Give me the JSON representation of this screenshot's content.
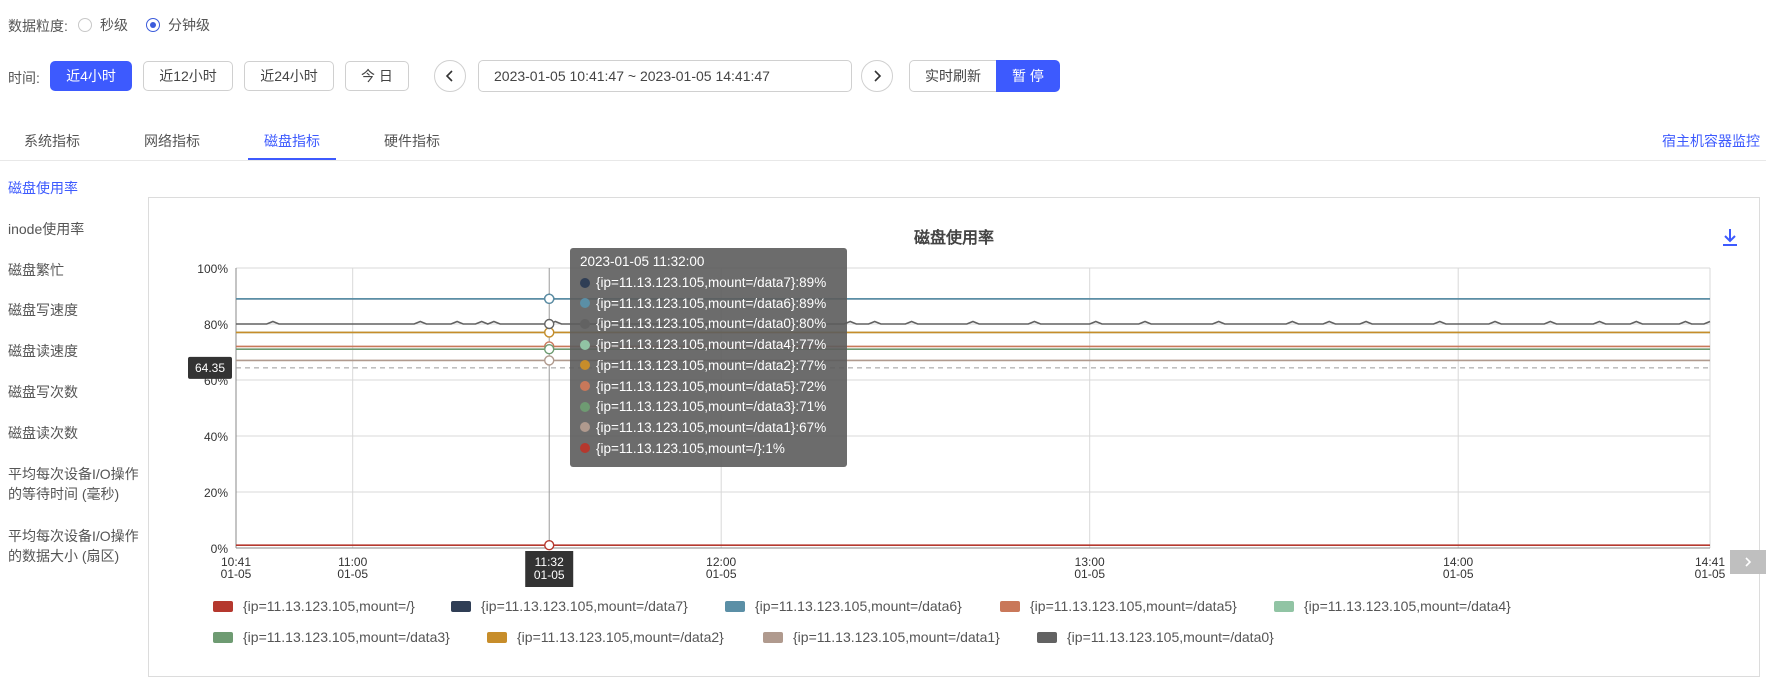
{
  "granularity": {
    "label": "数据粒度:",
    "options": [
      "秒级",
      "分钟级"
    ],
    "selected": "分钟级"
  },
  "time": {
    "label": "时间:",
    "quick": [
      "近4小时",
      "近12小时",
      "近24小时",
      "今 日"
    ],
    "active_quick": "近4小时",
    "range": "2023-01-05 10:41:47 ~ 2023-01-05 14:41:47",
    "realtime": "实时刷新",
    "pause": "暂 停"
  },
  "tabs": [
    "系统指标",
    "网络指标",
    "磁盘指标",
    "硬件指标"
  ],
  "active_tab": "磁盘指标",
  "host_link": "宿主机容器监控",
  "sidebar": [
    "磁盘使用率",
    "inode使用率",
    "磁盘繁忙",
    "磁盘写速度",
    "磁盘读速度",
    "磁盘写次数",
    "磁盘读次数",
    [
      "平均每次设备I/O操作",
      "的等待时间 (毫秒)"
    ],
    [
      "平均每次设备I/O操作",
      "的数据大小 (扇区)"
    ]
  ],
  "chart_data": {
    "type": "line",
    "title": "磁盘使用率",
    "y_ticks": [
      "100%",
      "80%",
      "60%",
      "40%",
      "20%",
      "0%"
    ],
    "ylim": [
      0,
      100
    ],
    "x_ticks": [
      {
        "t": 0,
        "time": "10:41",
        "date": "01-05"
      },
      {
        "t": 19,
        "time": "11:00",
        "date": "01-05"
      },
      {
        "t": 79,
        "time": "12:00",
        "date": "01-05"
      },
      {
        "t": 139,
        "time": "13:00",
        "date": "01-05"
      },
      {
        "t": 199,
        "time": "14:00",
        "date": "01-05"
      },
      {
        "t": 240,
        "time": "14:41",
        "date": "01-05"
      }
    ],
    "x_range_minutes": [
      0,
      240
    ],
    "crosshair": {
      "t": 51,
      "time": "11:32",
      "date": "01-05"
    },
    "reference_line": {
      "value": 64.35,
      "label": "64.35"
    },
    "series": [
      {
        "name": "{ip=11.13.123.105,mount=/}",
        "value": 1,
        "color": "#b5382e"
      },
      {
        "name": "{ip=11.13.123.105,mount=/data7}",
        "value": 89,
        "color": "#2f3e55"
      },
      {
        "name": "{ip=11.13.123.105,mount=/data6}",
        "value": 89,
        "color": "#5b8fa6"
      },
      {
        "name": "{ip=11.13.123.105,mount=/data5}",
        "value": 72,
        "color": "#c9785a"
      },
      {
        "name": "{ip=11.13.123.105,mount=/data4}",
        "value": 77,
        "color": "#91c4a4"
      },
      {
        "name": "{ip=11.13.123.105,mount=/data3}",
        "value": 71,
        "color": "#6e9b72"
      },
      {
        "name": "{ip=11.13.123.105,mount=/data2}",
        "value": 77,
        "color": "#c78d2a"
      },
      {
        "name": "{ip=11.13.123.105,mount=/data1}",
        "value": 67,
        "color": "#b09a8e"
      },
      {
        "name": "{ip=11.13.123.105,mount=/data0}",
        "value": 80,
        "color": "#626262"
      }
    ],
    "tooltip": {
      "time": "2023-01-05 11:32:00",
      "rows": [
        {
          "text": "{ip=11.13.123.105,mount=/data7}:89%",
          "color": "#2f3e55"
        },
        {
          "text": "{ip=11.13.123.105,mount=/data6}:89%",
          "color": "#5b8fa6"
        },
        {
          "text": "{ip=11.13.123.105,mount=/data0}:80%",
          "color": "#626262"
        },
        {
          "text": "{ip=11.13.123.105,mount=/data4}:77%",
          "color": "#91c4a4"
        },
        {
          "text": "{ip=11.13.123.105,mount=/data2}:77%",
          "color": "#c78d2a"
        },
        {
          "text": "{ip=11.13.123.105,mount=/data5}:72%",
          "color": "#c9785a"
        },
        {
          "text": "{ip=11.13.123.105,mount=/data3}:71%",
          "color": "#6e9b72"
        },
        {
          "text": "{ip=11.13.123.105,mount=/data1}:67%",
          "color": "#b09a8e"
        },
        {
          "text": "{ip=11.13.123.105,mount=/}:1%",
          "color": "#b5382e"
        }
      ]
    }
  },
  "colors": {
    "accent": "#3d5afe"
  }
}
